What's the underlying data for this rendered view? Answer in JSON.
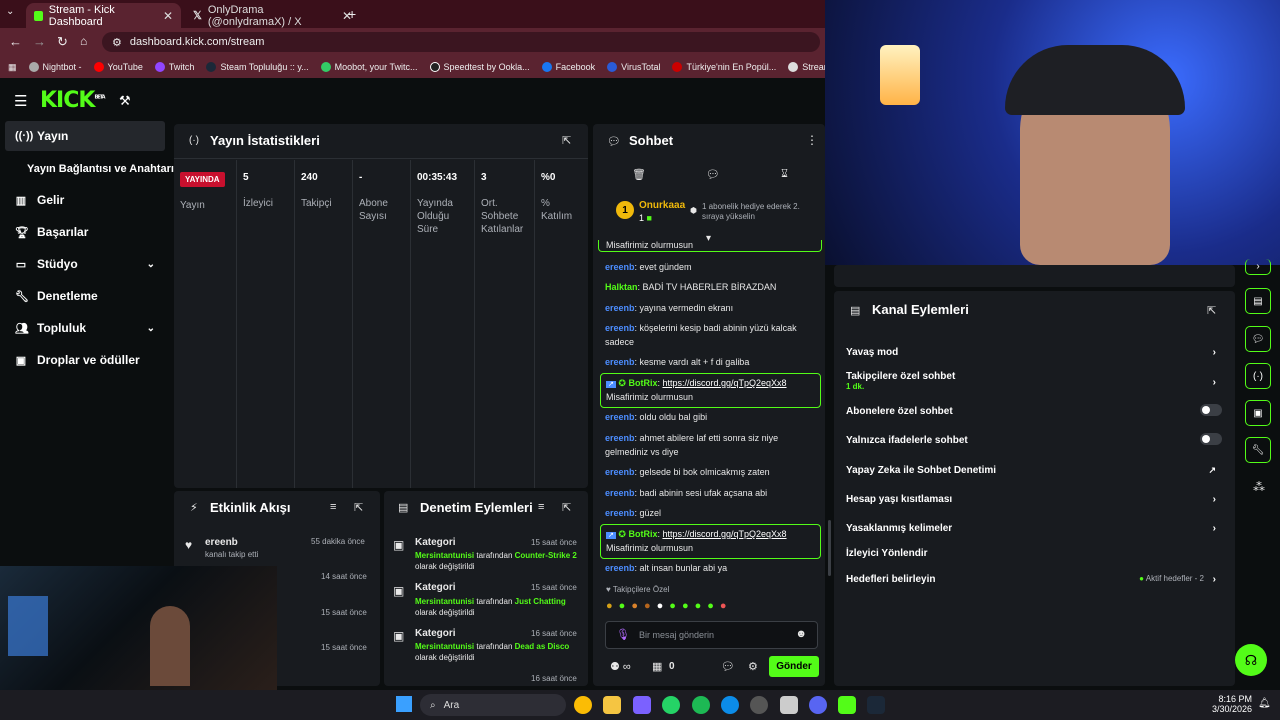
{
  "browser": {
    "tabs": [
      {
        "title": "Stream - Kick Dashboard",
        "active": true
      },
      {
        "title": "OnlyDrama (@onlydramaX) / X",
        "active": false
      }
    ],
    "url": "dashboard.kick.com/stream",
    "bookmarks": [
      "Nightbot -",
      "YouTube",
      "Twitch",
      "Steam Topluluğu :: y...",
      "Moobot, your Twitc...",
      "Speedtest by Ookla...",
      "Facebook",
      "VirusTotal",
      "Türkiye'nin En Popül...",
      "StreamElements"
    ]
  },
  "kick": {
    "logo": "KICK",
    "beta": "BETA"
  },
  "sidebar": [
    {
      "label": "Yayın",
      "icon": "broadcast-icon",
      "active": true
    },
    {
      "label": "Yayın Bağlantısı ve Anahtarı",
      "icon": "",
      "active": false
    },
    {
      "label": "Gelir",
      "icon": "chart-icon"
    },
    {
      "label": "Başarılar",
      "icon": "trophy-icon"
    },
    {
      "label": "Stüdyo",
      "icon": "monitor-icon"
    },
    {
      "label": "Denetleme",
      "icon": "wrench-icon"
    },
    {
      "label": "Topluluk",
      "icon": "people-icon"
    },
    {
      "label": "Droplar ve ödüller",
      "icon": "gift-icon"
    }
  ],
  "stats": {
    "title": "Yayın İstatistikleri",
    "live_badge": "YAYINDA",
    "live_label": "Yayın",
    "columns": [
      {
        "value": "5",
        "label": "İzleyici"
      },
      {
        "value": "240",
        "label": "Takipçi"
      },
      {
        "value": "-",
        "label": "Abone Sayısı"
      },
      {
        "value": "00:35:43",
        "label": "Yayında Olduğu Süre"
      },
      {
        "value": "3",
        "label": "Ort. Sohbete Katılanlar"
      },
      {
        "value": "%0",
        "label": "% Katılım"
      }
    ]
  },
  "activity": {
    "title": "Etkinlik Akışı",
    "items": [
      {
        "user": "ereenb",
        "desc": "kanalı takip etti",
        "time": "55 dakika önce"
      },
      {
        "time": "14 saat önce"
      },
      {
        "time": "15 saat önce"
      },
      {
        "time": "15 saat önce"
      }
    ]
  },
  "modactions": {
    "title": "Denetim Eylemleri",
    "items": [
      {
        "kind": "Kategori",
        "time": "15 saat önce",
        "user": "Mersintantunisi",
        "mid": "tarafından",
        "value": "Counter-Strike 2",
        "tail": "olarak değiştirildi"
      },
      {
        "kind": "Kategori",
        "time": "15 saat önce",
        "user": "Mersintantunisi",
        "mid": "tarafından",
        "value": "Just Chatting",
        "tail": "olarak değiştirildi"
      },
      {
        "kind": "Kategori",
        "time": "16 saat önce",
        "user": "Mersintantunisi",
        "mid": "tarafından",
        "value": "Dead as Disco",
        "tail": "olarak değiştirildi"
      },
      {
        "kind": "Kategori",
        "time": "16 saat önce"
      }
    ]
  },
  "chat": {
    "title": "Sohbet",
    "pinned_user": "Onurkaaa",
    "pinned_count": "1",
    "pinned_msg": "1 abonelik hediye ederek 2. sıraya yükselin",
    "top_partial": "Misafirimiz olurmusun",
    "messages": [
      {
        "user": "ereenb",
        "text": ": evet gündem",
        "color": "blue"
      },
      {
        "user": "Halktan",
        "text": ": BADİ TV HABERLER BİRAZDAN",
        "color": "green"
      },
      {
        "user": "ereenb",
        "text": ": yayına vermedin ekranı",
        "color": "blue"
      },
      {
        "user": "ereenb",
        "text": ": köşelerini kesip badi abinin yüzü kalcak sadece",
        "color": "blue"
      },
      {
        "user": "ereenb",
        "text": ": kesme vardı alt + f di galiba",
        "color": "blue"
      },
      {
        "user": "ereenb",
        "text": ": oldu oldu bal gibi",
        "color": "blue"
      },
      {
        "user": "ereenb",
        "text": ": ahmet abilere laf etti sonra siz niye gelmediniz vs diye",
        "color": "blue"
      },
      {
        "user": "ereenb",
        "text": ": gelsede bi bok olmicakmış zaten",
        "color": "blue"
      },
      {
        "user": "ereenb",
        "text": ": badi abinin sesi ufak açsana abi",
        "color": "blue"
      },
      {
        "user": "ereenb",
        "text": ": güzel",
        "color": "blue"
      },
      {
        "user": "ereenb",
        "text": ": alt insan bunlar abi ya",
        "color": "blue"
      }
    ],
    "bot": {
      "user": "BotRix",
      "link": "https://discord.gg/qTpQ2eqXx8",
      "text": "Misafirimiz olurmusun"
    },
    "followers_only": "Takipçilere Özel",
    "input_placeholder": "Bir mesaj gönderin",
    "footer_count": "0",
    "send": "Gönder"
  },
  "channel_actions": {
    "title": "Kanal Eylemleri",
    "items": [
      {
        "label": "Yavaş mod",
        "control": "arrow"
      },
      {
        "label": "Takipçilere özel sohbet",
        "sub": "1 dk.",
        "control": "arrow"
      },
      {
        "label": "Abonelere özel sohbet",
        "control": "toggle"
      },
      {
        "label": "Yalnızca ifadelerle sohbet",
        "control": "toggle"
      },
      {
        "label": "Yapay Zeka ile Sohbet Denetimi",
        "control": "external"
      },
      {
        "label": "Hesap yaşı kısıtlaması",
        "control": "arrow"
      },
      {
        "label": "Yasaklanmış kelimeler",
        "control": "arrow"
      },
      {
        "label": "İzleyici Yönlendir",
        "control": "none"
      },
      {
        "label": "Hedefleri belirleyin",
        "badge": "Aktif hedefler - 2",
        "control": "arrow"
      }
    ]
  },
  "taskbar": {
    "search": "Ara",
    "time": "8:16 PM",
    "date": "3/30/2026"
  },
  "colors": {
    "kick_green": "#53fc18",
    "panel": "#181b1f",
    "bg": "#0b0e0f",
    "user_blue": "#4c8dff"
  }
}
